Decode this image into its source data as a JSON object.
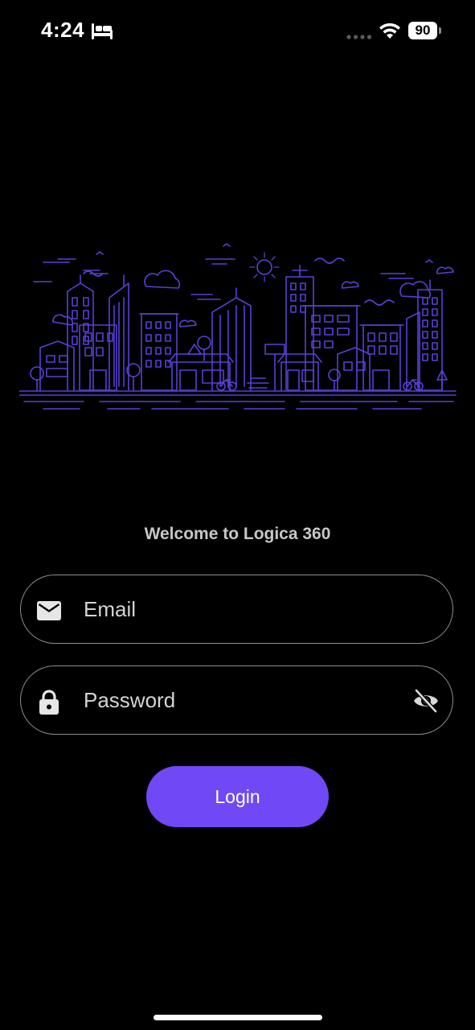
{
  "status_bar": {
    "time": "4:24",
    "battery_level": "90",
    "icons": [
      "sleep-focus-icon",
      "cellular-signal-icon",
      "wifi-icon",
      "battery-icon"
    ]
  },
  "illustration": {
    "name": "city-skyline-illustration",
    "color": "#5b3fd6"
  },
  "welcome_text": "Welcome to Logica 360",
  "form": {
    "email": {
      "placeholder": "Email",
      "value": "",
      "icon": "mail-icon"
    },
    "password": {
      "placeholder": "Password",
      "value": "",
      "icon": "lock-icon",
      "toggle_icon": "eye-off-icon"
    },
    "login_label": "Login"
  },
  "colors": {
    "background": "#000000",
    "accent": "#7048f5",
    "field_border": "#8e8e93",
    "welcome_text": "#c7c7c7"
  }
}
